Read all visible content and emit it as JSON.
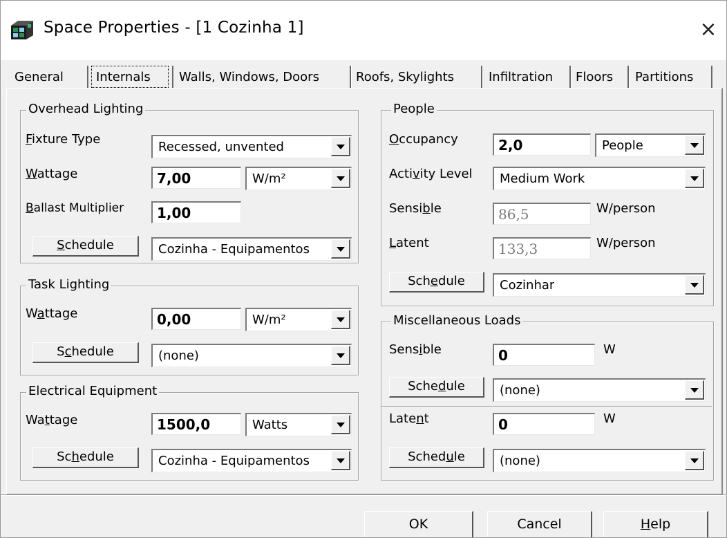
{
  "window": {
    "title": "Space Properties - [1 Cozinha 1]",
    "close_glyph": "×",
    "app_icon": "hap-app-icon"
  },
  "tabs": [
    {
      "label": "General"
    },
    {
      "label": "Internals",
      "active": true
    },
    {
      "label": "Walls, Windows, Doors"
    },
    {
      "label": "Roofs, Skylights"
    },
    {
      "label": "Infiltration"
    },
    {
      "label": "Floors"
    },
    {
      "label": "Partitions"
    }
  ],
  "overhead_lighting": {
    "title": "Overhead Lighting",
    "fixture_label_pre": "",
    "fixture_label_ul": "F",
    "fixture_label_post": "ixture Type",
    "fixture_value": "Recessed, unvented",
    "wattage_label_ul": "W",
    "wattage_label_post": "attage",
    "wattage_value": "7,00",
    "wattage_unit": "W/m²",
    "ballast_label_ul": "B",
    "ballast_label_post": "allast Multiplier",
    "ballast_value": "1,00",
    "schedule_btn_ul": "S",
    "schedule_btn_post": "chedule",
    "schedule_value": "Cozinha - Equipamentos"
  },
  "task_lighting": {
    "title": "Task Lighting",
    "wattage_pre": "W",
    "wattage_ul": "a",
    "wattage_post": "ttage",
    "wattage_value": "0,00",
    "wattage_unit": "W/m²",
    "schedule_pre": "S",
    "schedule_ul": "c",
    "schedule_post": "hedule",
    "schedule_value": "(none)"
  },
  "electrical_equipment": {
    "title": "Electrical Equipment",
    "wattage_pre": "Wa",
    "wattage_ul": "t",
    "wattage_post": "tage",
    "wattage_value": "1500,0",
    "wattage_unit": "Watts",
    "schedule_pre": "Sc",
    "schedule_ul": "h",
    "schedule_post": "edule",
    "schedule_value": "Cozinha - Equipamentos"
  },
  "people": {
    "title": "People",
    "occupancy_ul": "O",
    "occupancy_post": "ccupancy",
    "occupancy_value": "2,0",
    "occupancy_unit": "People",
    "activity_pre": "Acti",
    "activity_ul": "v",
    "activity_post": "ity Level",
    "activity_value": "Medium Work",
    "sensible_pre": "Sensi",
    "sensible_ul": "b",
    "sensible_post": "le",
    "sensible_value": "86,5",
    "sensible_unit": "W/person",
    "latent_ul": "L",
    "latent_post": "atent",
    "latent_value": "133,3",
    "latent_unit": "W/person",
    "schedule_pre": "Sch",
    "schedule_ul": "e",
    "schedule_post": "dule",
    "schedule_value": "Cozinhar"
  },
  "misc_loads": {
    "title": "Miscellaneous Loads",
    "sensible_pre": "Sens",
    "sensible_ul": "i",
    "sensible_post": "ble",
    "sensible_value": "0",
    "sensible_unit": "W",
    "schedule1_pre": "Sche",
    "schedule1_ul": "d",
    "schedule1_post": "ule",
    "schedule1_value": "(none)",
    "latent_pre": "Late",
    "latent_ul": "n",
    "latent_post": "t",
    "latent_value": "0",
    "latent_unit": "W",
    "schedule2_pre": "Sched",
    "schedule2_ul": "u",
    "schedule2_post": "le",
    "schedule2_value": "(none)"
  },
  "footer": {
    "ok_label": "OK",
    "cancel_label": "Cancel",
    "help_ul": "H",
    "help_post": "elp"
  }
}
